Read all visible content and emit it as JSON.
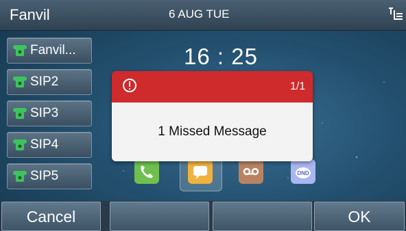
{
  "statusbar": {
    "brand": "Fanvil",
    "date": "6 AUG TUE",
    "network_icon": "network-icon"
  },
  "lines": [
    {
      "label": "Fanvil...",
      "icon": "phone-icon"
    },
    {
      "label": "SIP2",
      "icon": "phone-icon"
    },
    {
      "label": "SIP3",
      "icon": "phone-icon"
    },
    {
      "label": "SIP4",
      "icon": "phone-icon"
    },
    {
      "label": "SIP5",
      "icon": "phone-icon"
    }
  ],
  "clock": "16 : 25",
  "apps": [
    {
      "name": "call-app-icon",
      "color": "#6fc04f"
    },
    {
      "name": "messages-app-icon",
      "color": "#f0b23f"
    },
    {
      "name": "voicemail-app-icon",
      "color": "#b98363"
    },
    {
      "name": "dnd-app-icon",
      "color": "#a9b6ef"
    }
  ],
  "popup": {
    "counter": "1/1",
    "message": "1 Missed Message",
    "header_color": "#cf2a2c",
    "icon": "alert-icon"
  },
  "softkeys": [
    "Cancel",
    "",
    "",
    "OK"
  ]
}
